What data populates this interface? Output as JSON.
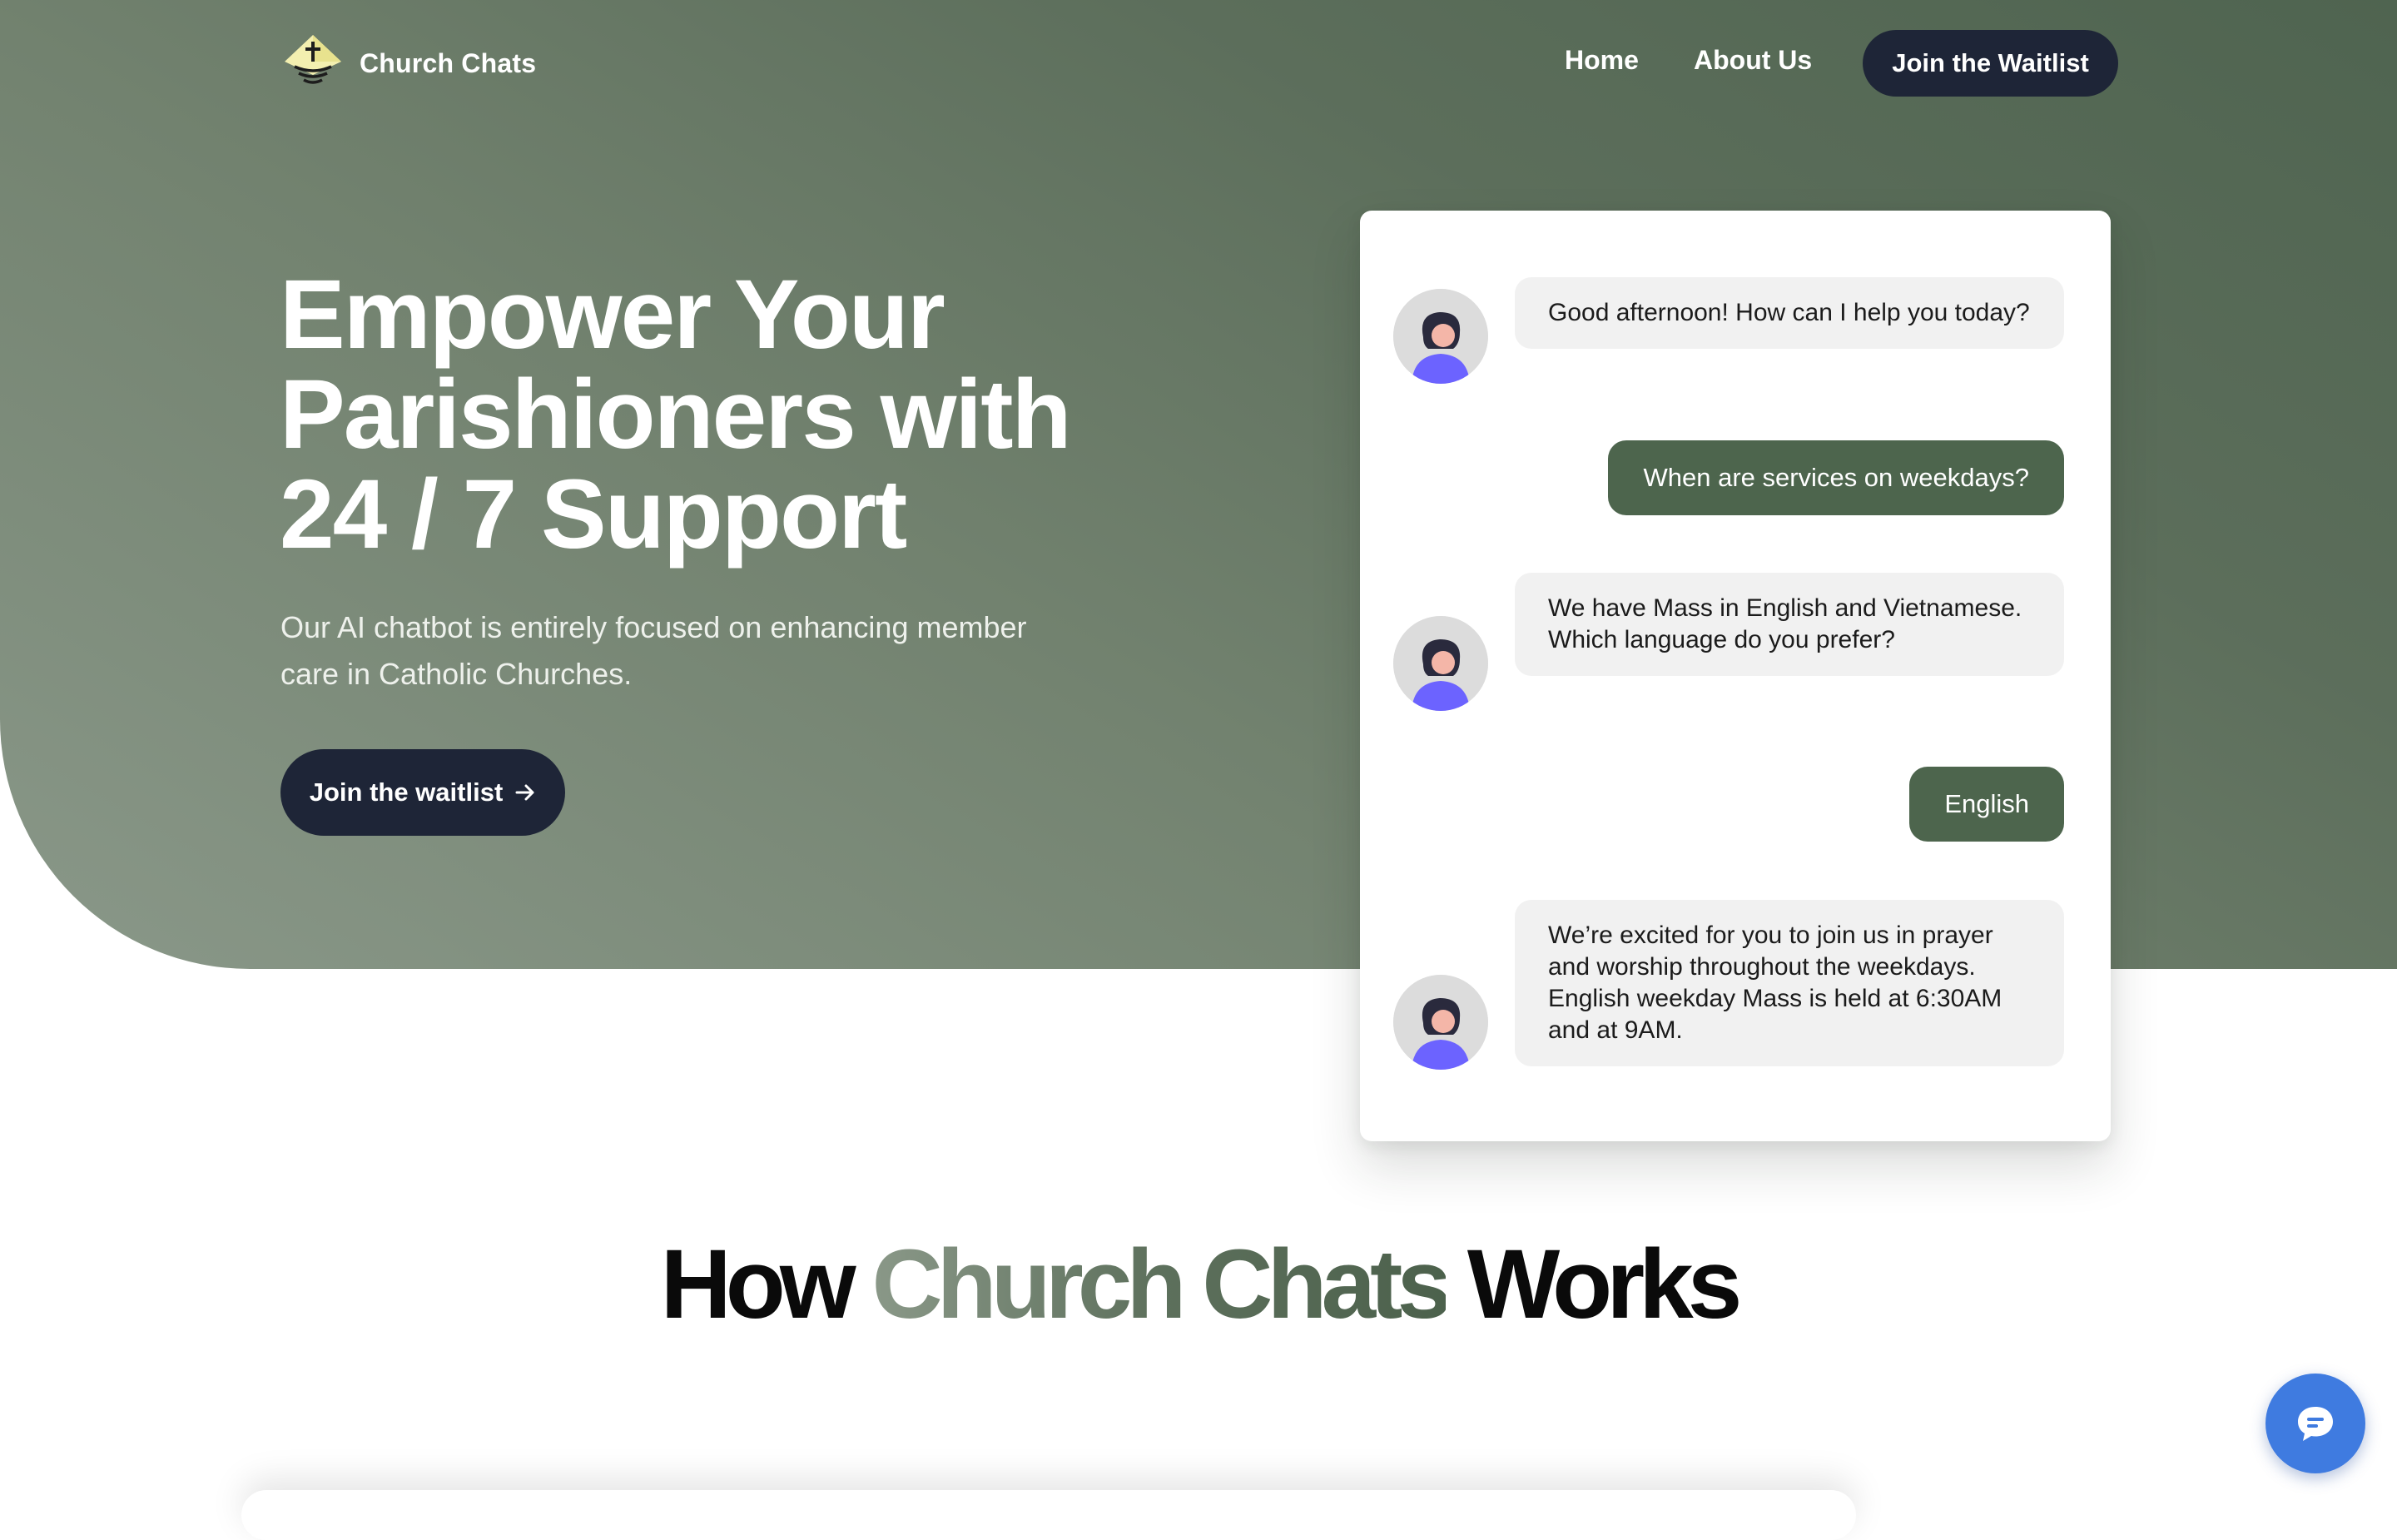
{
  "nav": {
    "brand": "Church Chats",
    "logo_icon": "church-cross-diamond-icon",
    "links": [
      "Home",
      "About Us"
    ],
    "cta": "Join the Waitlist"
  },
  "hero": {
    "title_lines": [
      "Empower Your",
      "Parishioners with",
      "24 / 7 Support"
    ],
    "subtitle": "Our AI chatbot is entirely focused on enhancing member care in Catholic Churches.",
    "cta": "Join the waitlist",
    "cta_icon": "arrow-right-icon"
  },
  "chat": {
    "messages": [
      {
        "from": "bot",
        "text": "Good afternoon! How can I help you today?"
      },
      {
        "from": "user",
        "text": "When are services on weekdays?"
      },
      {
        "from": "bot",
        "text": "We have Mass in English and Vietnamese. Which language do you prefer?"
      },
      {
        "from": "user",
        "text": "English"
      },
      {
        "from": "bot",
        "text": "We’re excited for you to join us in prayer and worship throughout the weekdays. English weekday Mass is held at 6:30AM and at 9AM."
      }
    ]
  },
  "section": {
    "heading_start": "How ",
    "heading_accent": "Church Chats",
    "heading_end": " Works"
  },
  "fab": {
    "icon": "chat-bubble-icon"
  },
  "colors": {
    "hero_green": "#5c6e5b",
    "navy": "#1e2537",
    "user_bubble": "#4d654d",
    "bot_bubble": "#f1f1f1",
    "fab_blue": "#3f7be0"
  }
}
